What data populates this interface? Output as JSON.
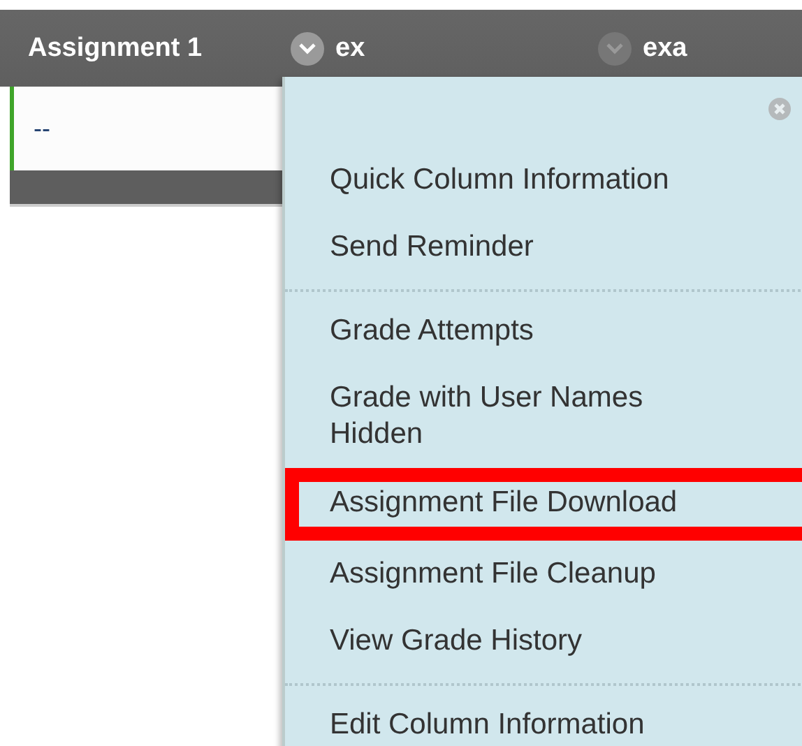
{
  "columns": [
    {
      "label": "Assignment 1"
    },
    {
      "label": "ex",
      "menu_open": true
    },
    {
      "label": "exa",
      "menu_open": false
    }
  ],
  "row": {
    "cell": "--"
  },
  "menu": {
    "sections": [
      [
        {
          "label": "Quick Column Information",
          "highlighted": false
        },
        {
          "label": "Send Reminder",
          "highlighted": false
        }
      ],
      [
        {
          "label": "Grade Attempts",
          "highlighted": false
        },
        {
          "label": "Grade with User Names Hidden",
          "highlighted": false
        },
        {
          "label": "Assignment File Download",
          "highlighted": true
        },
        {
          "label": "Assignment File Cleanup",
          "highlighted": false
        },
        {
          "label": "View Grade History",
          "highlighted": false
        }
      ],
      [
        {
          "label": "Edit Column Information",
          "highlighted": false
        }
      ]
    ]
  }
}
